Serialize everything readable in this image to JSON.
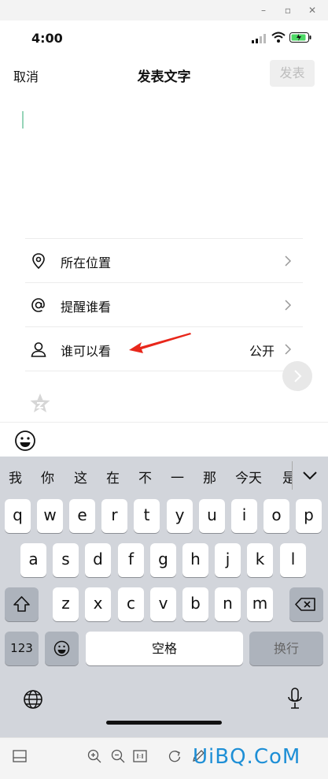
{
  "status": {
    "time": "4:00"
  },
  "nav": {
    "cancel": "取消",
    "title": "发表文字",
    "publish": "发表"
  },
  "options": [
    {
      "label": "所在位置",
      "value": "",
      "icon": "location-pin-icon"
    },
    {
      "label": "提醒谁看",
      "value": "",
      "icon": "at-sign-icon"
    },
    {
      "label": "谁可以看",
      "value": "公开",
      "icon": "person-icon"
    }
  ],
  "keyboard": {
    "candidates": [
      "我",
      "你",
      "这",
      "在",
      "不",
      "一",
      "那",
      "今天",
      "是"
    ],
    "row1": [
      "q",
      "w",
      "e",
      "r",
      "t",
      "y",
      "u",
      "i",
      "o",
      "p"
    ],
    "row2": [
      "a",
      "s",
      "d",
      "f",
      "g",
      "h",
      "j",
      "k",
      "l"
    ],
    "row3": [
      "z",
      "x",
      "c",
      "v",
      "b",
      "n",
      "m"
    ],
    "num_key": "123",
    "space": "空格",
    "return": "换行"
  },
  "watermark": "UiBQ.CoM",
  "colors": {
    "annotation_arrow": "#e8271b",
    "watermark": "#1e8fd6",
    "keyboard_bg": "#d2d5db"
  }
}
